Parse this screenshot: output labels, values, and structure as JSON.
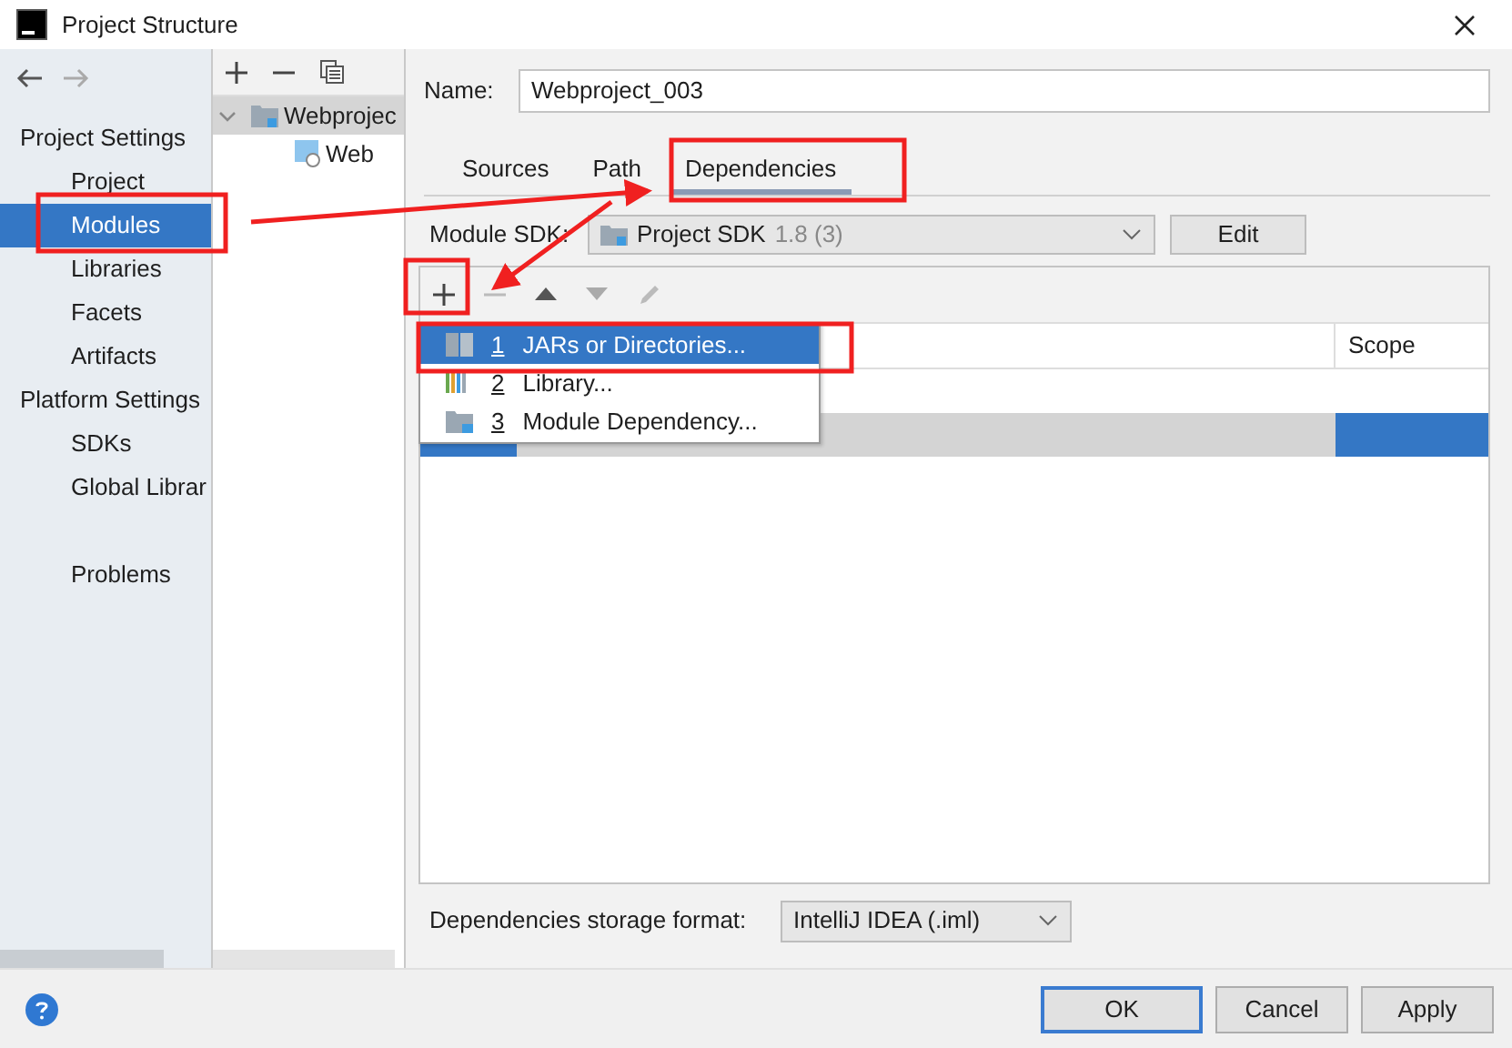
{
  "window": {
    "title": "Project Structure"
  },
  "sidebar": {
    "groups": [
      {
        "heading": "Project Settings",
        "items": [
          {
            "label": "Project",
            "selected": false
          },
          {
            "label": "Modules",
            "selected": true
          },
          {
            "label": "Libraries",
            "selected": false
          },
          {
            "label": "Facets",
            "selected": false
          },
          {
            "label": "Artifacts",
            "selected": false
          }
        ]
      },
      {
        "heading": "Platform Settings",
        "items": [
          {
            "label": "SDKs",
            "selected": false
          },
          {
            "label": "Global Librar",
            "selected": false
          }
        ]
      }
    ],
    "footer_items": [
      {
        "label": "Problems",
        "selected": false
      }
    ]
  },
  "module_tree": [
    {
      "label": "Webprojec",
      "selected": true,
      "expanded": true,
      "children": [
        {
          "label": "Web",
          "selected": false
        }
      ]
    }
  ],
  "details": {
    "name_label": "Name:",
    "name_value": "Webproject_003",
    "tabs": [
      {
        "label": "Sources",
        "selected": false
      },
      {
        "label": "Path",
        "selected": false
      },
      {
        "label": "Dependencies",
        "selected": true
      }
    ],
    "module_sdk": {
      "label": "Module SDK:",
      "value": "Project SDK",
      "version": "1.8 (3)"
    },
    "edit_button": "Edit",
    "dependency_table": {
      "columns": [
        {
          "label": "Scope"
        }
      ],
      "rows": [
        {
          "selected": true
        }
      ]
    },
    "add_menu": [
      {
        "kind": "jar",
        "number": "1",
        "label": "JARs or Directories...",
        "selected": true
      },
      {
        "kind": "library",
        "number": "2",
        "label": "Library...",
        "selected": false
      },
      {
        "kind": "module",
        "number": "3",
        "label": "Module Dependency...",
        "selected": false
      }
    ],
    "storage_format": {
      "label": "Dependencies storage format:",
      "value": "IntelliJ IDEA (.iml)"
    }
  },
  "buttons": [
    {
      "label": "OK",
      "default": true
    },
    {
      "label": "Cancel",
      "default": false
    },
    {
      "label": "Apply",
      "default": false
    }
  ]
}
